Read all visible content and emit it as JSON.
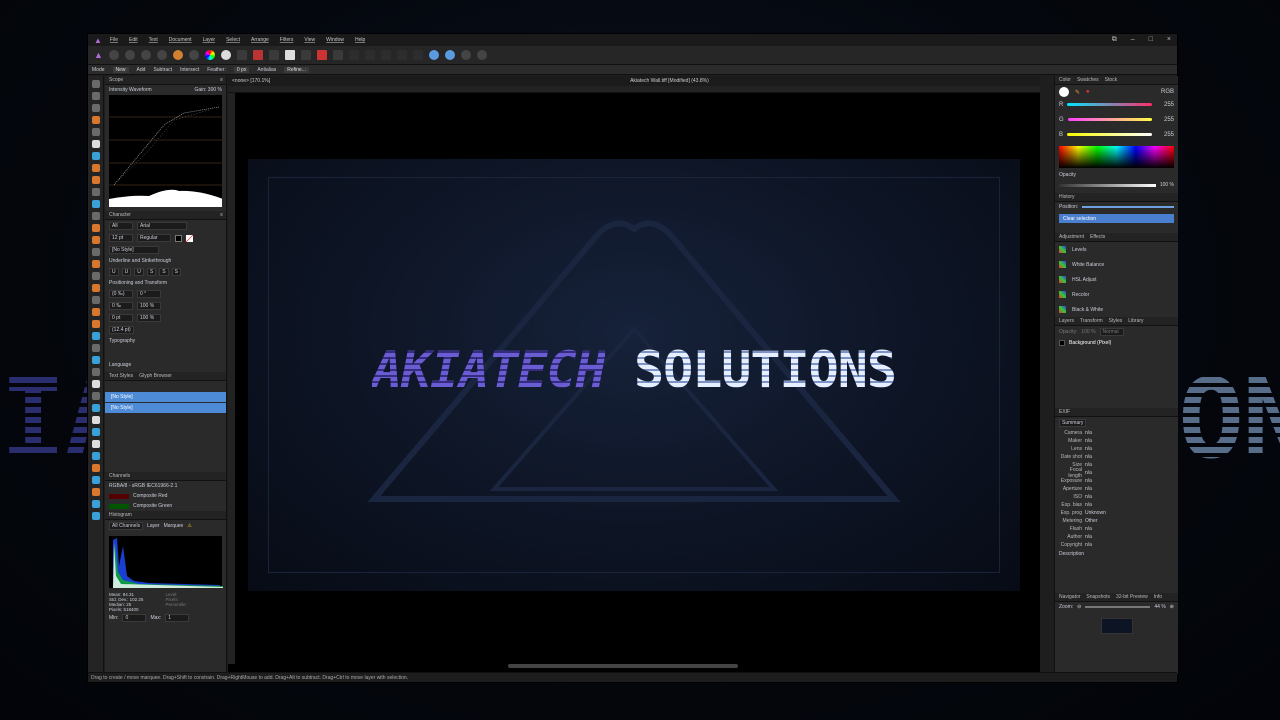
{
  "background": {
    "left_fragment": "IA",
    "right_fragment": "ON"
  },
  "menu": [
    "File",
    "Edit",
    "Text",
    "Document",
    "Layer",
    "Select",
    "Arrange",
    "Filters",
    "View",
    "Window",
    "Help"
  ],
  "context_bar": {
    "mode_label": "Mode",
    "modes": [
      "New",
      "Add",
      "Subtract",
      "Intersect"
    ],
    "feather_label": "Feather:",
    "feather_value": "0 px",
    "antialias_label": "Antialias",
    "refine_label": "Refine..."
  },
  "left_panel": {
    "scope_tab": "Scope",
    "scope_mode": "Intensity Waveform",
    "scope_gain": "Gain: 300 %",
    "character_tab": "Character",
    "font_scope": "All",
    "font_name": "Arial",
    "font_size": "12 pt",
    "font_style": "Regular",
    "no_style": "[No Style]",
    "underline_section": "Underline and Strikethrough",
    "positioning_section": "Positioning and Transform",
    "pos_values": [
      "(0 ‰)",
      "0 °",
      "0 ‰",
      "100 %",
      "0 pt",
      "100 %",
      "(12.4 pt)"
    ],
    "typography_section": "Typography",
    "language_section": "Language",
    "text_styles_tab": "Text Styles",
    "glyph_browser_tab": "Glyph Browser",
    "styles": [
      "[No Style]",
      "[No Style]"
    ],
    "channels_tab": "Channels",
    "channel_profile": "RGBA/8 - sRGB IEC61966-2.1",
    "channels": [
      "Composite Red",
      "Composite Green"
    ],
    "histogram_tab": "Histogram",
    "histogram_channel": "All Channels",
    "histogram_opts": [
      "Layer",
      "Marquee"
    ],
    "stats": [
      "Mean: 84.31",
      "Std. Dev.: 102.25",
      "Median: 25",
      "Pixels: 518400"
    ],
    "stats_right": [
      "Level:",
      "Pixels:",
      "Percentile:"
    ],
    "min_label": "Min:",
    "min_value": "0",
    "max_label": "Max:",
    "max_value": "1"
  },
  "doc_tabs": [
    "<none> [170.1%]",
    "Akiatech Wall.tiff [Modified] (43.8%)"
  ],
  "artwork": {
    "word1": "AKIATECH",
    "word2": "SOLUTIONS"
  },
  "right_panel": {
    "color_tabs": [
      "Color",
      "Swatches",
      "Stock"
    ],
    "color_model": "RGB",
    "rgb_labels": [
      "R",
      "G",
      "B"
    ],
    "rgb_values": [
      "255",
      "255",
      "255"
    ],
    "opacity_label": "Opacity",
    "opacity_value": "100 %",
    "history_tab": "History",
    "position_label": "Position:",
    "history_item": "Clear selection",
    "adjustment_tabs": [
      "Adjustment",
      "Effects"
    ],
    "adjustments": [
      "Levels",
      "White Balance",
      "HSL Adjust",
      "Recolor",
      "Black & White"
    ],
    "layers_tabs": [
      "Layers",
      "Transform",
      "Styles",
      "Library"
    ],
    "opacity_short": "Opacity:",
    "opacity_short_value": "100 %",
    "blend_mode": "Normal",
    "layer_name": "Background (Pixel)",
    "exif_tab": "EXIF",
    "exif_summary": "Summary",
    "exif_rows": [
      [
        "Camera",
        "n/a"
      ],
      [
        "Maker",
        "n/a"
      ],
      [
        "Lens",
        "n/a"
      ],
      [
        "Date shot",
        "n/a"
      ],
      [
        "Size",
        "n/a"
      ],
      [
        "Focal length",
        "n/a"
      ],
      [
        "Exposure",
        "n/a"
      ],
      [
        "Aperture",
        "n/a"
      ],
      [
        "ISO",
        "n/a"
      ],
      [
        "Exp. bias",
        "n/a"
      ],
      [
        "Exp. prog",
        "Unknown"
      ],
      [
        "Metering",
        "Other"
      ],
      [
        "Flash",
        "n/a"
      ],
      [
        "Author",
        "n/a"
      ],
      [
        "Copyright",
        "n/a"
      ]
    ],
    "description_label": "Description",
    "navigator_tabs": [
      "Navigator",
      "Snapshots",
      "32-bit Preview",
      "Info"
    ],
    "zoom_label": "Zoom:",
    "zoom_value": "44 %"
  },
  "status_text": "Drag to create / move marquee. Drag+Shift to constrain. Drag+RightMouse to add. Drag+Alt to subtract. Drag+Ctrl to move layer with selection."
}
